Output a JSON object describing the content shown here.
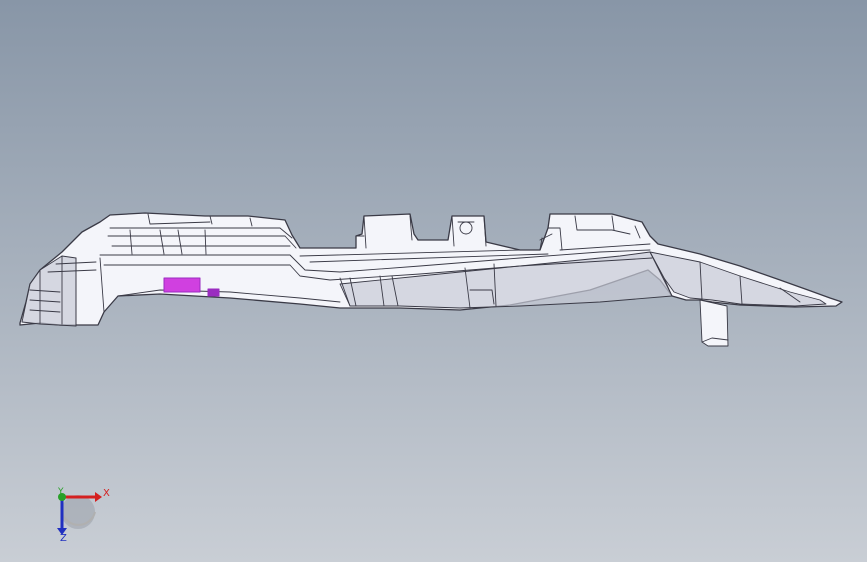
{
  "viewport": {
    "background_top": "#8896a7",
    "background_bottom": "#c9ced5",
    "part_fill": "#f4f5fa",
    "part_edge": "#3a3a46",
    "shade_fill": "#c8cad6",
    "highlight_color": "#d040e0",
    "highlight_dark": "#9a2cc0"
  },
  "triad": {
    "x_label": "X",
    "y_label": "Y",
    "z_label": "Z",
    "x_color": "#d42020",
    "y_color": "#28a028",
    "z_color": "#2030c0"
  }
}
